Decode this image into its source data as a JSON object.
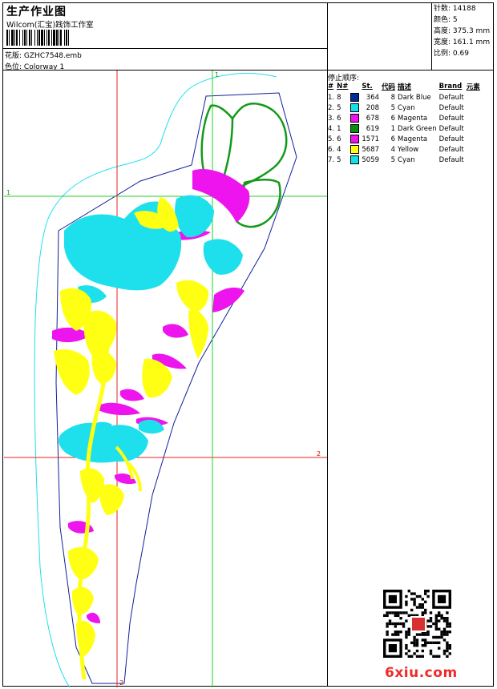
{
  "header": {
    "title": "生产作业图",
    "company": "Wilcom(汇宝)践饰工作室",
    "design_label": "花版:",
    "design_value": "GZHC7548.emb",
    "color_label": "色位:",
    "color_value": "Colorway 1"
  },
  "stats": {
    "stitches_label": "针数:",
    "stitches": "14188",
    "colors_label": "颜色:",
    "colors": "5",
    "height_label": "高度:",
    "height": "375.3 mm",
    "width_label": "宽度:",
    "width": "161.1 mm",
    "scale_label": "比例:",
    "scale": "0.69"
  },
  "stop_sequence": {
    "title": "停止顺序:",
    "headers": [
      "#",
      "N#",
      "St.",
      "代码",
      "描述",
      "Brand",
      "元素"
    ],
    "rows": [
      {
        "no": "1.",
        "n": "8",
        "color": "#002a9a",
        "st": "364",
        "code": "8",
        "desc": "Dark Blue",
        "brand": "Default"
      },
      {
        "no": "2.",
        "n": "5",
        "color": "#14e0e8",
        "st": "208",
        "code": "5",
        "desc": "Cyan",
        "brand": "Default"
      },
      {
        "no": "3.",
        "n": "6",
        "color": "#ee12ee",
        "st": "678",
        "code": "6",
        "desc": "Magenta",
        "brand": "Default"
      },
      {
        "no": "4.",
        "n": "1",
        "color": "#0a8c12",
        "st": "619",
        "code": "1",
        "desc": "Dark Green",
        "brand": "Default"
      },
      {
        "no": "5.",
        "n": "6",
        "color": "#ee12ee",
        "st": "1571",
        "code": "6",
        "desc": "Magenta",
        "brand": "Default"
      },
      {
        "no": "6.",
        "n": "4",
        "color": "#ffff10",
        "st": "5687",
        "code": "4",
        "desc": "Yellow",
        "brand": "Default"
      },
      {
        "no": "7.",
        "n": "5",
        "color": "#14e0e8",
        "st": "5059",
        "code": "5",
        "desc": "Cyan",
        "brand": "Default"
      }
    ]
  },
  "guides": {
    "marker_1": "1",
    "marker_2": "2"
  },
  "palette": {
    "cyan": "#1de0ec",
    "yellow": "#ffff14",
    "magenta": "#ee14ee",
    "green": "#129a1a",
    "blue": "#10209a"
  },
  "watermark": "6xiu.com"
}
